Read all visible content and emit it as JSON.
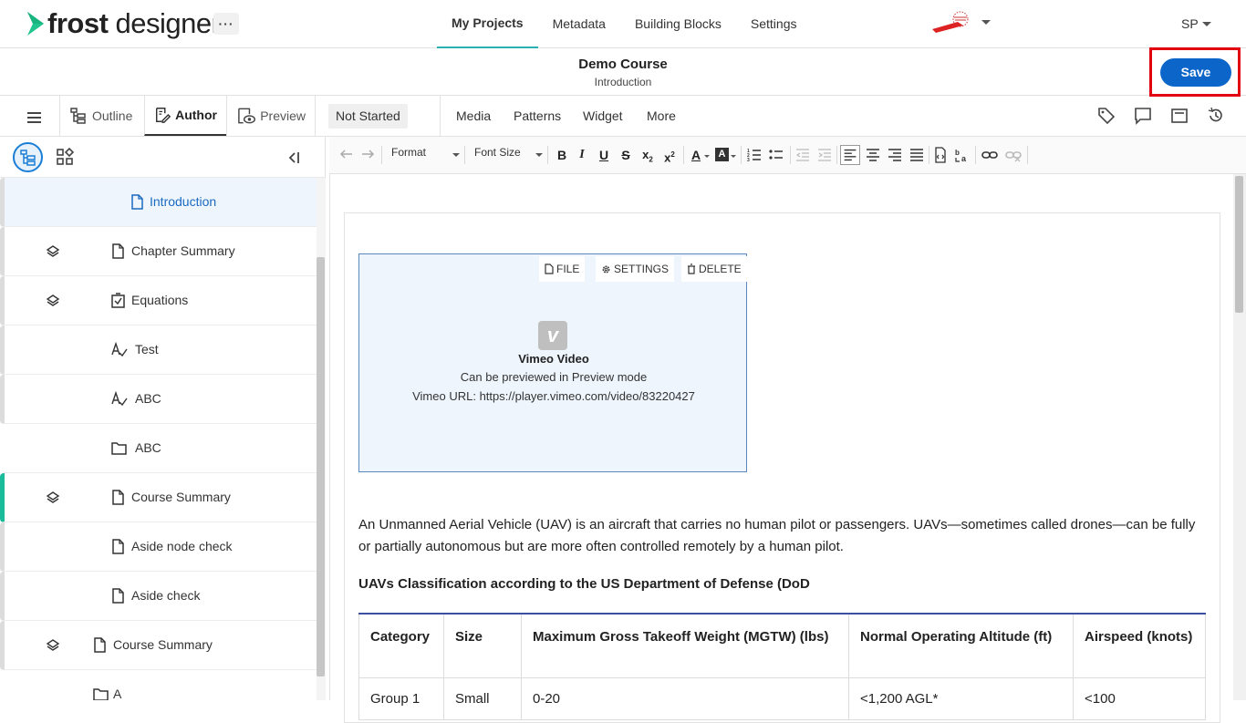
{
  "app": {
    "logo_text_bold": "frost",
    "logo_text_light": " designer",
    "more_label": "···"
  },
  "nav": {
    "items": [
      {
        "label": "My Projects",
        "active": true
      },
      {
        "label": "Metadata"
      },
      {
        "label": "Building Blocks"
      },
      {
        "label": "Settings"
      }
    ]
  },
  "user": {
    "initials": "SP"
  },
  "course": {
    "title": "Demo Course",
    "subtitle": "Introduction"
  },
  "save_label": "Save",
  "modebar": {
    "tabs": [
      {
        "label": "Outline"
      },
      {
        "label": "Author",
        "active": true
      },
      {
        "label": "Preview"
      }
    ],
    "status": "Not Started",
    "insert": [
      "Media",
      "Patterns",
      "Widget",
      "More"
    ]
  },
  "tree": {
    "nodes": [
      {
        "label": "Introduction",
        "icon": "page-icon",
        "selected": true
      },
      {
        "label": "Chapter Summary",
        "icon": "page-icon",
        "layers": true
      },
      {
        "label": "Equations",
        "icon": "checklist-icon",
        "layers": true
      },
      {
        "label": "Test",
        "icon": "assessment-icon"
      },
      {
        "label": "ABC",
        "icon": "assessment-icon"
      },
      {
        "label": "ABC",
        "icon": "folder-icon",
        "noborder": true
      },
      {
        "label": "Course Summary",
        "icon": "page-icon",
        "layers": true,
        "accent": true
      },
      {
        "label": "Aside node check",
        "icon": "page-icon"
      },
      {
        "label": "Aside check",
        "icon": "page-icon"
      },
      {
        "label": "Course Summary",
        "icon": "page-icon",
        "layers": true
      },
      {
        "label": "A",
        "icon": "folder-icon",
        "noborder": true
      }
    ]
  },
  "editor_toolbar": {
    "format_label": "Format",
    "font_size_label": "Font Size"
  },
  "media": {
    "tools": [
      "FILE",
      "SETTINGS",
      "DELETE"
    ],
    "title": "Vimeo Video",
    "line1": "Can be previewed in Preview mode",
    "line2": "Vimeo URL: https://player.vimeo.com/video/83220427"
  },
  "content": {
    "paragraph": "An Unmanned Aerial Vehicle (UAV) is an aircraft that carries no human pilot or passengers. UAVs—sometimes called drones—can be fully or partially autonomous but are more often controlled remotely by a human pilot.",
    "subheading": "UAVs Classification according to the US Department of Defense (DoD",
    "table": {
      "headers": [
        "Category",
        "Size",
        "Maximum Gross Takeoff Weight (MGTW) (lbs)",
        "Normal Operating Altitude (ft)",
        "Airspeed (knots)"
      ],
      "rows": [
        [
          "Group 1",
          "Small",
          "0-20",
          "<1,200 AGL*",
          "<100"
        ]
      ]
    }
  },
  "colors": {
    "accent": "#2db0b3",
    "save": "#0c66c9",
    "highlight": "#e3000f",
    "selection": "#1a6ac0"
  }
}
